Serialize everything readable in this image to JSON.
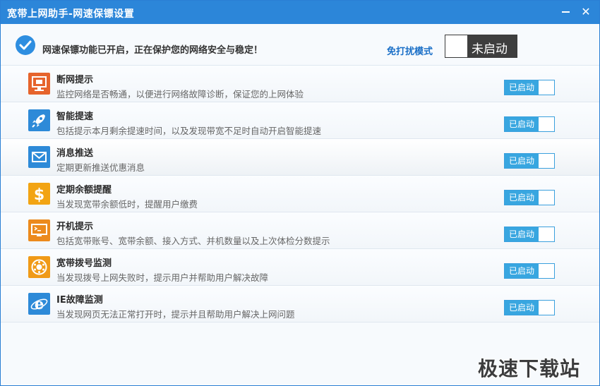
{
  "window": {
    "title": "宽带上网助手-网速保镖设置"
  },
  "status": {
    "message": "网速保镖功能已开启，正在保护您的网络安全与稳定！",
    "mode_label": "免打扰模式",
    "mode_toggle_text": "未启动"
  },
  "features": [
    {
      "name": "断网提示",
      "desc": "监控网络是否畅通，以便进行网络故障诊断，保证您的上网体验",
      "toggle": "已启动",
      "icon": "monitor-icon",
      "color": "#e6642c"
    },
    {
      "name": "智能提速",
      "desc": "包括提示本月剩余提速时间，以及发现带宽不足时自动开启智能提速",
      "toggle": "已启动",
      "icon": "rocket-icon",
      "color": "#2d8ad8"
    },
    {
      "name": "消息推送",
      "desc": "定期更新推送优惠消息",
      "toggle": "已启动",
      "icon": "envelope-icon",
      "color": "#2d8ad8"
    },
    {
      "name": "定期余额提醒",
      "desc": "当发现宽带余额低时，提醒用户缴费",
      "toggle": "已启动",
      "icon": "dollar-icon",
      "color": "#f2a413"
    },
    {
      "name": "开机提示",
      "desc": "包括宽带账号、宽带余额、接入方式、并机数量以及上次体检分数提示",
      "toggle": "已启动",
      "icon": "terminal-icon",
      "color": "#ec8a1d"
    },
    {
      "name": "宽带拨号监测",
      "desc": "当发现拨号上网失败时，提示用户并帮助用户解决故障",
      "toggle": "已启动",
      "icon": "dial-icon",
      "color": "#f09a17"
    },
    {
      "name": "IE故障监测",
      "desc": "当发现网页无法正常打开时，提示并且帮助用户解决上网问题",
      "toggle": "已启动",
      "icon": "ie-icon",
      "color": "#2d8ad8"
    }
  ],
  "watermark": "极速下载站"
}
